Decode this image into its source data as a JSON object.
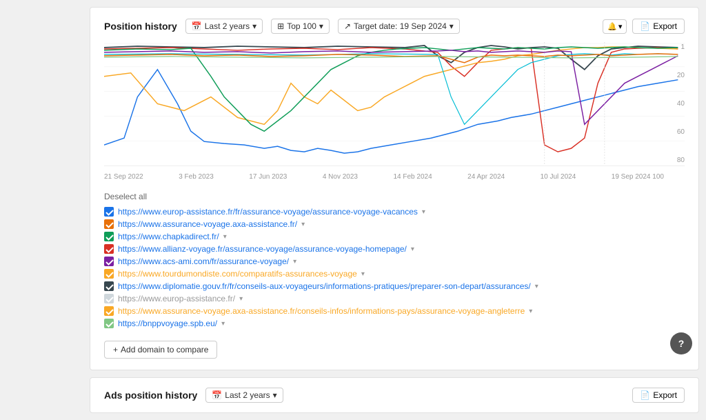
{
  "header": {
    "title": "Position history",
    "filters": {
      "period_label": "Last 2 years",
      "period_icon": "📅",
      "top_label": "Top 100",
      "top_icon": "⊞",
      "target_label": "Target date: 19 Sep 2024",
      "target_icon": "↗"
    },
    "notification_label": "🔔",
    "export_label": "Export",
    "export_icon": "📄"
  },
  "chart": {
    "x_labels": [
      "21 Sep 2022",
      "3 Feb 2023",
      "17 Jun 2023",
      "4 Nov 2023",
      "14 Feb 2024",
      "24 Apr 2024",
      "10 Jul 2024",
      "19 Sep 2024"
    ],
    "y_labels": [
      "1",
      "20",
      "40",
      "60",
      "80",
      "100"
    ]
  },
  "domains": {
    "deselect_label": "Deselect all",
    "add_btn_label": "Add domain to compare",
    "items": [
      {
        "url": "https://www.europ-assistance.fr/fr/assurance-voyage/assurance-voyage-vacances",
        "color": "#1a73e8",
        "checked": true,
        "opacity": 1
      },
      {
        "url": "https://www.assurance-voyage.axa-assistance.fr/",
        "color": "#e8710a",
        "checked": true,
        "opacity": 1
      },
      {
        "url": "https://www.chapkadirect.fr/",
        "color": "#0f9d58",
        "checked": true,
        "opacity": 1
      },
      {
        "url": "https://www.allianz-voyage.fr/assurance-voyage/assurance-voyage-homepage/",
        "color": "#d93025",
        "checked": true,
        "opacity": 1
      },
      {
        "url": "https://www.acs-ami.com/fr/assurance-voyage/",
        "color": "#7b1fa2",
        "checked": true,
        "opacity": 1
      },
      {
        "url": "https://www.tourdumondiste.com/comparatifs-assurances-voyage",
        "color": "#f9a825",
        "checked": true,
        "opacity": 1,
        "highlight": true
      },
      {
        "url": "https://www.diplomatie.gouv.fr/fr/conseils-aux-voyageurs/informations-pratiques/preparer-son-depart/assurances/",
        "color": "#37474f",
        "checked": true,
        "opacity": 1
      },
      {
        "url": "https://www.europ-assistance.fr/",
        "color": "#b0bec5",
        "checked": true,
        "opacity": 0.5
      },
      {
        "url": "https://www.assurance-voyage.axa-assistance.fr/conseils-infos/informations-pays/assurance-voyage-angleterre",
        "color": "#f9a825",
        "checked": true,
        "opacity": 1,
        "highlight": true
      },
      {
        "url": "https://bnppvoyage.spb.eu/",
        "color": "#81c784",
        "checked": true,
        "opacity": 1
      }
    ]
  },
  "ads_section": {
    "title": "Ads position history",
    "period_label": "Last 2 years",
    "export_label": "Export"
  }
}
